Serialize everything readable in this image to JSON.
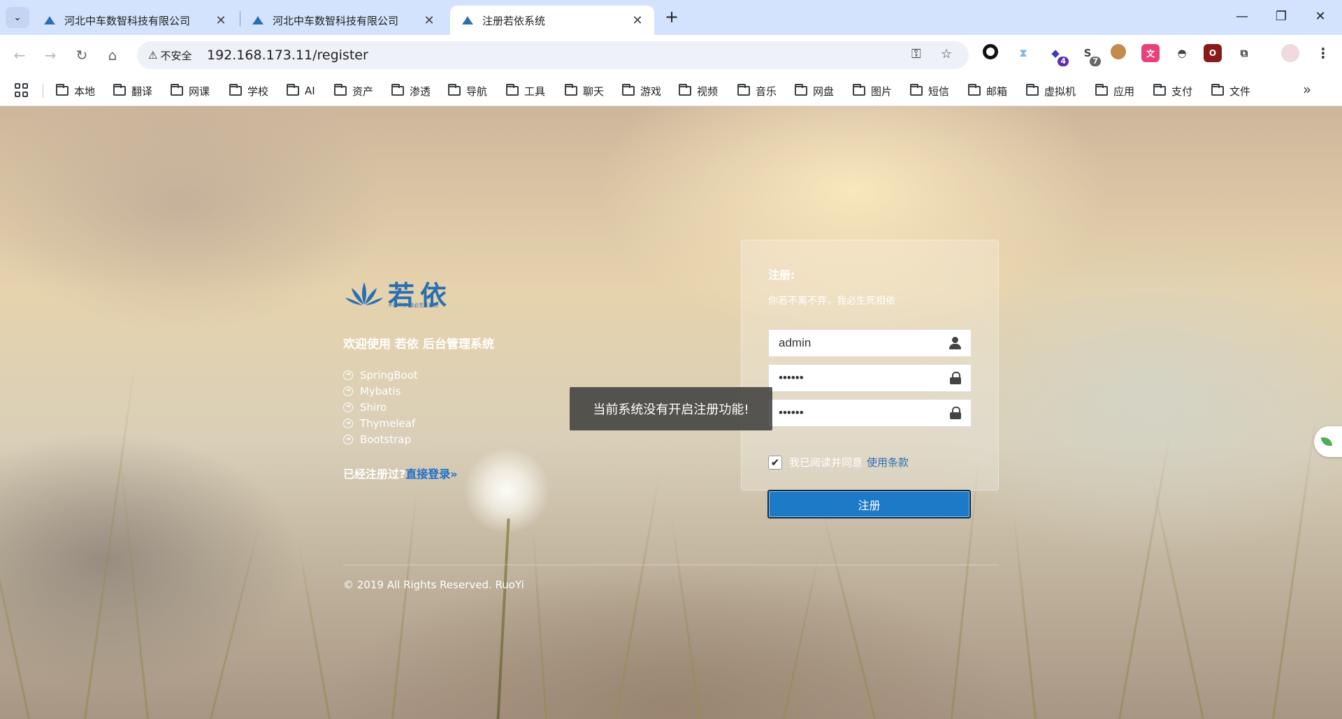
{
  "browser": {
    "tabs": [
      {
        "title": "河北中车数智科技有限公司",
        "close": "✕"
      },
      {
        "title": "河北中车数智科技有限公司",
        "close": "✕"
      },
      {
        "title": "注册若依系统",
        "close": "✕"
      }
    ],
    "new_tab": "+",
    "window_controls": {
      "minimize": "—",
      "restore": "❐",
      "close": "✕"
    },
    "security_label": "不安全",
    "url": "192.168.173.11/register",
    "extension_badges": {
      "ext4": "4",
      "ext5": "7"
    },
    "bookmarks": [
      "本地",
      "翻译",
      "网课",
      "学校",
      "AI",
      "资产",
      "渗透",
      "导航",
      "工具",
      "聊天",
      "游戏",
      "视频",
      "音乐",
      "网盘",
      "图片",
      "短信",
      "邮箱",
      "虚拟机",
      "应用",
      "支付",
      "文件"
    ],
    "bookmarks_overflow": "»"
  },
  "page": {
    "logo_text": "若依",
    "logo_subtext": "不离不弃 我必生死相依",
    "welcome": "欢迎使用 若依 后台管理系统",
    "tech_stack": [
      "SpringBoot",
      "Mybatis",
      "Shiro",
      "Thymeleaf",
      "Bootstrap"
    ],
    "already_registered": "已经注册过?",
    "login_link": "直接登录»",
    "copyright": "© 2019 All Rights Reserved. RuoYi"
  },
  "register_form": {
    "title": "注册:",
    "subtitle": "你若不离不弃，我必生死相依",
    "username_value": "admin",
    "password_value": "••••••",
    "confirm_password_value": "••••••",
    "agree_text": "我已阅读并同意",
    "terms_link": "使用条款",
    "checkbox_checked": true,
    "submit_label": "注册",
    "accent_color": "#1c7ac7"
  },
  "toast": {
    "message": "当前系统没有开启注册功能!"
  }
}
